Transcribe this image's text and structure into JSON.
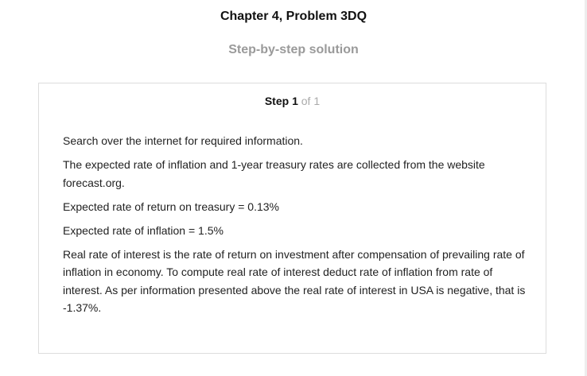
{
  "header": {
    "chapter_title": "Chapter 4, Problem 3DQ",
    "subtitle": "Step-by-step solution"
  },
  "step": {
    "word": "Step",
    "number": "1",
    "of_word": "of",
    "total": "1",
    "paragraphs": [
      "Search over the internet for required information.",
      "The expected rate of inflation and 1-year treasury rates are collected from the website forecast.org.",
      "Expected rate of return on treasury = 0.13%",
      "Expected rate of inflation = 1.5%",
      "Real rate of interest is the rate of return on investment after compensation of prevailing rate of inflation in economy. To compute real rate of interest deduct rate of inflation from rate of interest. As per information presented above the real rate of interest in USA is negative, that is -1.37%."
    ]
  }
}
